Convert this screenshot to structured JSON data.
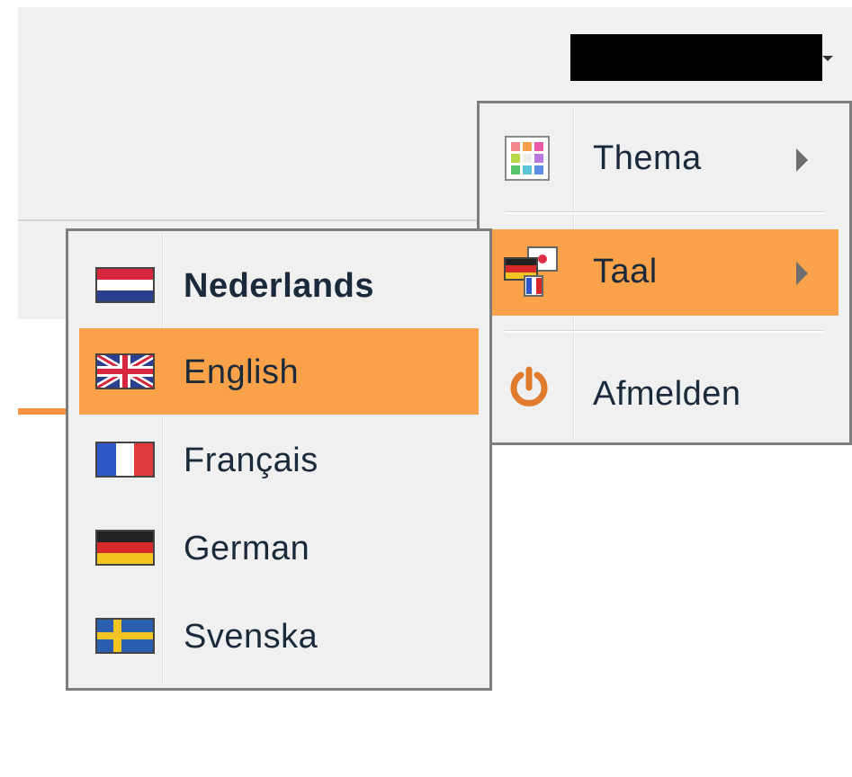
{
  "header": {
    "user_menu_icon": "chevron-down-icon"
  },
  "main_menu": {
    "items": [
      {
        "label": "Thema",
        "icon": "theme-grid-icon",
        "has_submenu": true
      },
      {
        "label": "Taal",
        "icon": "language-flags-icon",
        "has_submenu": true,
        "active": true
      },
      {
        "label": "Afmelden",
        "icon": "power-icon",
        "has_submenu": false
      }
    ]
  },
  "language_menu": {
    "items": [
      {
        "label": "Nederlands",
        "icon": "flag-nl-icon"
      },
      {
        "label": "English",
        "icon": "flag-gb-icon",
        "active": true
      },
      {
        "label": "Français",
        "icon": "flag-fr-icon"
      },
      {
        "label": "German",
        "icon": "flag-de-icon"
      },
      {
        "label": "Svenska",
        "icon": "flag-se-icon"
      }
    ]
  },
  "colors": {
    "highlight": "#f9a24a",
    "accent_orange": "#f5923e",
    "menu_background": "#f0f0f0",
    "menu_border": "#7e7e7e"
  }
}
